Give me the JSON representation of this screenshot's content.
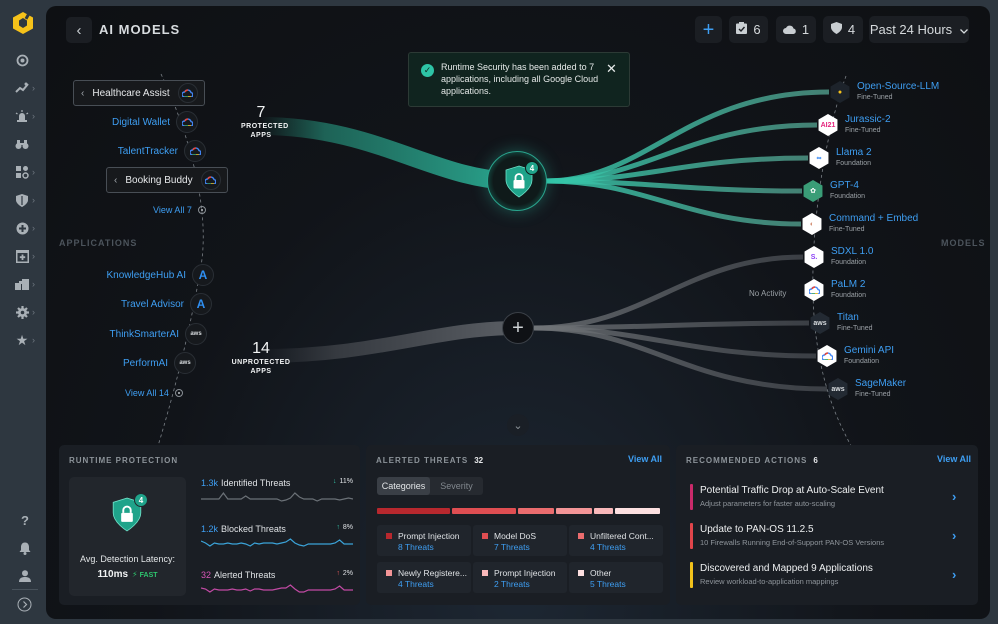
{
  "header": {
    "back_label": "‹",
    "title": "AI MODELS",
    "add_icon": "plus-icon",
    "tasks": {
      "icon": "clipboard-check-icon",
      "count": "6"
    },
    "clouds": {
      "icon": "cloud-icon",
      "count": "1"
    },
    "shields": {
      "icon": "shield-icon",
      "count": "4"
    },
    "time_range": "Past 24 Hours"
  },
  "sidebar": {
    "items": [
      {
        "icon": "radar-icon"
      },
      {
        "icon": "activity-icon"
      },
      {
        "icon": "alert-siren-icon"
      },
      {
        "icon": "binoculars-icon"
      },
      {
        "icon": "apps-settings-icon"
      },
      {
        "icon": "shield-icon"
      },
      {
        "icon": "plus-circle-icon"
      },
      {
        "icon": "add-window-icon"
      },
      {
        "icon": "blocks-icon"
      },
      {
        "icon": "gear-icon"
      },
      {
        "icon": "star-icon"
      }
    ],
    "bottom": [
      {
        "icon": "help-icon",
        "glyph": "?"
      },
      {
        "icon": "bell-icon"
      },
      {
        "icon": "user-icon"
      },
      {
        "icon": "expand-icon"
      }
    ]
  },
  "toast": {
    "message": "Runtime Security has been added to 7 applications, including all Google Cloud applications.",
    "status": "success"
  },
  "labels": {
    "applications": "APPLICATIONS",
    "models": "MODELS"
  },
  "protected": {
    "count": "7",
    "label": "PROTECTED APPS",
    "badge": "4",
    "apps": [
      {
        "name": "Healthcare Assist",
        "provider": "google-cloud",
        "expanded": true
      },
      {
        "name": "Digital Wallet",
        "provider": "google-cloud"
      },
      {
        "name": "TalentTracker",
        "provider": "google-cloud"
      },
      {
        "name": "Booking Buddy",
        "provider": "google-cloud",
        "expanded": true
      }
    ],
    "view_all": "View All 7"
  },
  "unprotected": {
    "count": "14",
    "label": "UNPROTECTED APPS",
    "apps": [
      {
        "name": "KnowledgeHub AI",
        "provider": "azure"
      },
      {
        "name": "Travel Advisor",
        "provider": "azure"
      },
      {
        "name": "ThinkSmarterAI",
        "provider": "aws"
      },
      {
        "name": "PerformAI",
        "provider": "aws"
      }
    ],
    "view_all": "View All 14"
  },
  "models": [
    {
      "name": "Open-Source-LLM",
      "type": "Fine-Tuned",
      "logo": "open-source-logo",
      "glyph": "●",
      "protected": true
    },
    {
      "name": "Jurassic-2",
      "type": "Fine-Tuned",
      "logo": "ai21-logo",
      "glyph": "AI21",
      "protected": true
    },
    {
      "name": "Llama 2",
      "type": "Foundation",
      "logo": "meta-logo",
      "glyph": "∞",
      "protected": true
    },
    {
      "name": "GPT-4",
      "type": "Foundation",
      "logo": "openai-logo",
      "glyph": "✿",
      "protected": true
    },
    {
      "name": "Command + Embed",
      "type": "Fine-Tuned",
      "logo": "cohere-logo",
      "glyph": "◐",
      "protected": true
    },
    {
      "name": "SDXL 1.0",
      "type": "Foundation",
      "logo": "stability-logo",
      "glyph": "S.",
      "protected": false
    },
    {
      "name": "PaLM 2",
      "type": "Foundation",
      "logo": "google-cloud-logo",
      "glyph": "☁",
      "protected": false,
      "note": "No Activity"
    },
    {
      "name": "Titan",
      "type": "Fine-Tuned",
      "logo": "aws-logo",
      "glyph": "aws",
      "protected": false
    },
    {
      "name": "Gemini API",
      "type": "Foundation",
      "logo": "google-cloud-logo",
      "glyph": "☁",
      "protected": false
    },
    {
      "name": "SageMaker",
      "type": "Fine-Tuned",
      "logo": "aws-logo",
      "glyph": "aws",
      "protected": false
    }
  ],
  "runtime": {
    "title": "RUNTIME PROTECTION",
    "badge": "4",
    "latency_label": "Avg. Detection Latency:",
    "latency_value": "110ms",
    "latency_status": "FAST",
    "metrics": [
      {
        "value": "1.3k",
        "label": "Identified Threats",
        "change": "11%",
        "direction": "down",
        "color": "#3e9ef2",
        "line": "#6b7177",
        "arrow_color": "#33c3a8"
      },
      {
        "value": "1.2k",
        "label": "Blocked Threats",
        "change": "8%",
        "direction": "up",
        "color": "#3e9ef2",
        "line": "#3ba3d8",
        "arrow_color": "#33c3a8"
      },
      {
        "value": "32",
        "label": "Alerted Threats",
        "change": "2%",
        "direction": "up",
        "color": "#d955b8",
        "line": "#c24aa4",
        "arrow_color": "#ef5b5b"
      }
    ]
  },
  "alerted": {
    "title": "ALERTED THREATS",
    "count": "32",
    "view_all": "View All",
    "tabs": [
      "Categories",
      "Severity"
    ],
    "active_tab": "Categories",
    "categories": [
      {
        "name": "Prompt Injection",
        "threats": "8 Threats",
        "count": 8,
        "color": "#b8282e"
      },
      {
        "name": "Model DoS",
        "threats": "7 Threats",
        "count": 7,
        "color": "#df4e52"
      },
      {
        "name": "Unfiltered Cont...",
        "threats": "4 Threats",
        "count": 4,
        "color": "#ea6c6e"
      },
      {
        "name": "Newly Registere...",
        "threats": "4 Threats",
        "count": 4,
        "color": "#f39597"
      },
      {
        "name": "Prompt Injection",
        "threats": "2 Threats",
        "count": 2,
        "color": "#f8b8ba"
      },
      {
        "name": "Other",
        "threats": "5 Threats",
        "count": 5,
        "color": "#fde0e1"
      }
    ]
  },
  "actions": {
    "title": "RECOMMENDED ACTIONS",
    "count": "6",
    "view_all": "View All",
    "items": [
      {
        "title": "Potential Traffic Drop at Auto-Scale Event",
        "subtitle": "Adjust parameters for faster auto-scaling",
        "color": "#c92a6a"
      },
      {
        "title": "Update to PAN-OS 11.2.5",
        "subtitle": "10 Firewalls Running End-of-Support PAN-OS Versions",
        "color": "#e0454b"
      },
      {
        "title": "Discovered and Mapped 9 Applications",
        "subtitle": "Review workload-to-application mappings",
        "color": "#f2c21b"
      }
    ]
  }
}
